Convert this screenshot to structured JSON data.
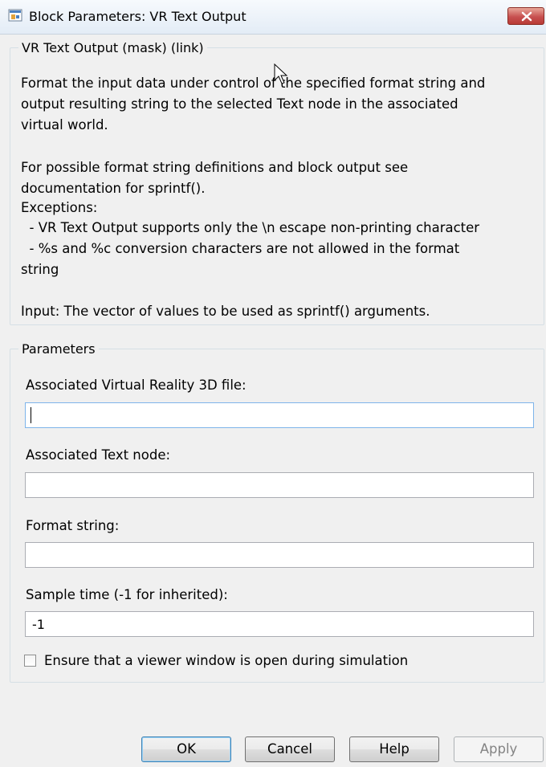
{
  "window": {
    "title": "Block Parameters: VR Text Output"
  },
  "description_group": {
    "legend": "VR Text Output (mask) (link)",
    "lines": [
      "Format the input data under control of the specified format string and",
      "output resulting string to the selected Text node in the associated",
      "virtual world.",
      "",
      "For possible format string definitions and block output see",
      "documentation for sprintf().",
      "Exceptions:",
      "  - VR Text Output supports only the \\n escape non-printing character",
      "  - %s and %c conversion characters are not allowed in the format",
      "string",
      "",
      "Input: The vector of values to be used as sprintf() arguments."
    ]
  },
  "parameters_group": {
    "legend": "Parameters",
    "vr_file_label": "Associated Virtual Reality 3D file:",
    "vr_file_value": "",
    "text_node_label": "Associated Text node:",
    "text_node_value": "",
    "format_label": "Format string:",
    "format_value": "",
    "sample_time_label": "Sample time (-1 for inherited):",
    "sample_time_value": "-1",
    "viewer_checkbox_label": "Ensure that a viewer window is open during simulation",
    "viewer_checkbox_checked": false
  },
  "buttons": {
    "ok": "OK",
    "cancel": "Cancel",
    "help": "Help",
    "apply": "Apply"
  },
  "colors": {
    "dialog_bg": "#f0f0f0",
    "close_button": "#c75050",
    "group_border": "#d5dfe5"
  }
}
